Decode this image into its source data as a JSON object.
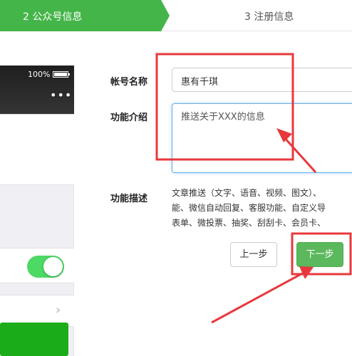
{
  "steps": {
    "active_label": "2 公众号信息",
    "next_label": "3 注册信息"
  },
  "phone": {
    "battery_text": "100%",
    "menu_glyph": "•••",
    "chevron_glyph": "›",
    "toggle_on": true
  },
  "form": {
    "name_label": "帐号名称",
    "name_value": "惠有千琪",
    "intro_label": "功能介绍",
    "intro_value": "推送关于XXX的信息",
    "desc_label": "功能描述",
    "desc_lines": [
      "文章推送（文字、语音、视频、图文）、",
      "能、微信自动回复、客服功能、自定义导",
      "表单、微投票、抽奖、刮刮卡、会员卡、"
    ]
  },
  "buttons": {
    "prev_label": "上一步",
    "next_label": "下一步"
  },
  "colors": {
    "step_active": "#44b549",
    "primary_button": "#5cb85c",
    "annotation": "#e8383d",
    "toggle": "#4cd964"
  },
  "icons": [
    "battery-icon",
    "more-icon",
    "chevron-right-icon",
    "arrow-annotation"
  ]
}
